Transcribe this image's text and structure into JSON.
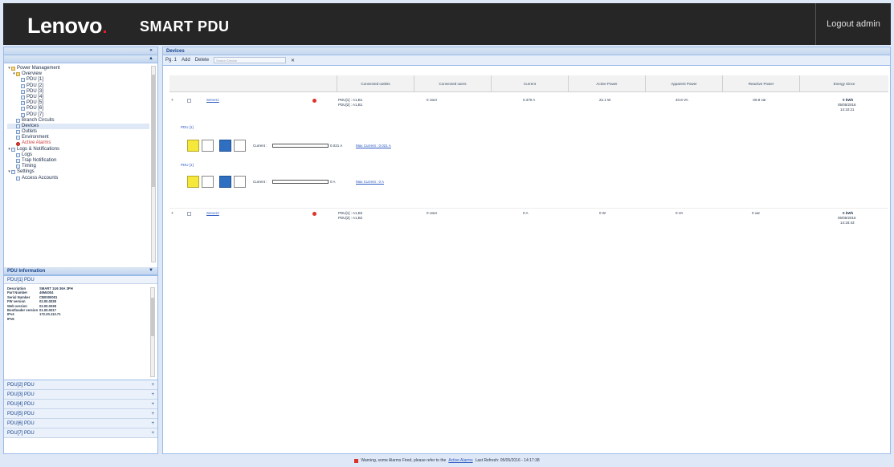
{
  "header": {
    "logo": "Lenovo",
    "product": "SMART PDU",
    "logout": "Logout admin"
  },
  "colors": {
    "header_bg": "#262626",
    "panel_bg": "#dfe8f6",
    "panel_border": "#99bbe8",
    "link": "#2a58c2",
    "error": "#e0322b",
    "outlet_yellow": "#f5e83a",
    "outlet_blue": "#2f6fc2"
  },
  "tree": {
    "items": [
      {
        "label": "Power Management",
        "icon": "folder-icon"
      },
      {
        "label": "Overview",
        "icon": "folder-icon"
      },
      {
        "label": "PDU [1]",
        "icon": "pdu-icon"
      },
      {
        "label": "PDU [2]",
        "icon": "pdu-icon"
      },
      {
        "label": "PDU [3]",
        "icon": "pdu-icon"
      },
      {
        "label": "PDU [4]",
        "icon": "pdu-icon"
      },
      {
        "label": "PDU [5]",
        "icon": "pdu-icon"
      },
      {
        "label": "PDU [6]",
        "icon": "pdu-icon"
      },
      {
        "label": "PDU [7]",
        "icon": "pdu-icon"
      },
      {
        "label": "Branch Circuits",
        "icon": "circuit-icon"
      },
      {
        "label": "Devices",
        "icon": "device-icon"
      },
      {
        "label": "Outlets",
        "icon": "outlet-icon"
      },
      {
        "label": "Environment",
        "icon": "environment-icon"
      },
      {
        "label": "Active Alarms",
        "icon": "alarm-icon"
      },
      {
        "label": "Logs & Notifications",
        "icon": "folder-icon"
      },
      {
        "label": "Logs",
        "icon": "log-icon"
      },
      {
        "label": "Trap Notification",
        "icon": "trap-icon"
      },
      {
        "label": "Timing",
        "icon": "timing-icon"
      },
      {
        "label": "Settings",
        "icon": "gear-icon"
      },
      {
        "label": "Access Accounts",
        "icon": "account-icon"
      }
    ]
  },
  "pdu_info": {
    "title": "PDU Information",
    "tab": "PDU[1]  PDU",
    "rows": [
      {
        "key": "Description",
        "value": "SMART 1U6 36A 3PH"
      },
      {
        "key": "Part Number",
        "value": "46M4004"
      },
      {
        "key": "Serial Number",
        "value": "CB0000001"
      },
      {
        "key": "FW version",
        "value": "02.00.0038"
      },
      {
        "key": "Web version",
        "value": "02.00.0038"
      },
      {
        "key": "Bootloader version",
        "value": "01.00.0017"
      },
      {
        "key": "IPv4",
        "value": "172.20.113.71"
      },
      {
        "key": "IPv6",
        "value": ""
      }
    ],
    "list": [
      "PDU[2]  PDU",
      "PDU[3]  PDU",
      "PDU[4]  PDU",
      "PDU[5]  PDU",
      "PDU[6]  PDU",
      "PDU[7]  PDU"
    ]
  },
  "main": {
    "title": "Devices",
    "toolbar": {
      "page": "Pg. 1",
      "add": "Add",
      "delete": "Delete",
      "search_placeholder": "Search Device"
    },
    "columns": [
      "Connected outlets",
      "Connected users",
      "Current",
      "Active Power",
      "Apparent Power",
      "Reactive Power",
      "Energy Since"
    ],
    "devices": [
      {
        "name": "Server1",
        "outlets": [
          "PDU[1] : A1,B1",
          "PDU[2] : A1,B1"
        ],
        "users": "0 User",
        "current": "0.370 A",
        "active": "22.1 W",
        "apparent": "40.8 VA",
        "reactive": "-29.9 var",
        "energy": "0 kWh",
        "energy_date": "05/05/2016",
        "energy_time": "14:10:21",
        "phases": [
          {
            "label": "PDU [1]",
            "current": "Current : ",
            "value": "0.021 A",
            "max": "Max Current : 0.021 A"
          },
          {
            "label": "PDU [1]",
            "current": "Current : ",
            "value": "0 A",
            "max": "Max Current : 0 A"
          }
        ]
      },
      {
        "name": "Server2",
        "outlets": [
          "PDU[1] : A1,B2",
          "PDU[2] : A1,B2"
        ],
        "users": "0 User",
        "current": "0 A",
        "active": "0 W",
        "apparent": "0 VA",
        "reactive": "0 var",
        "energy": "0 kWh",
        "energy_date": "05/05/2016",
        "energy_time": "14:16:43"
      }
    ]
  },
  "status": {
    "text": "Warning, some Alarms Fired, please refer to the",
    "link": "Active Alarms",
    "refresh": "Last Refresh: 05/05/2016 - 14:17:38"
  }
}
